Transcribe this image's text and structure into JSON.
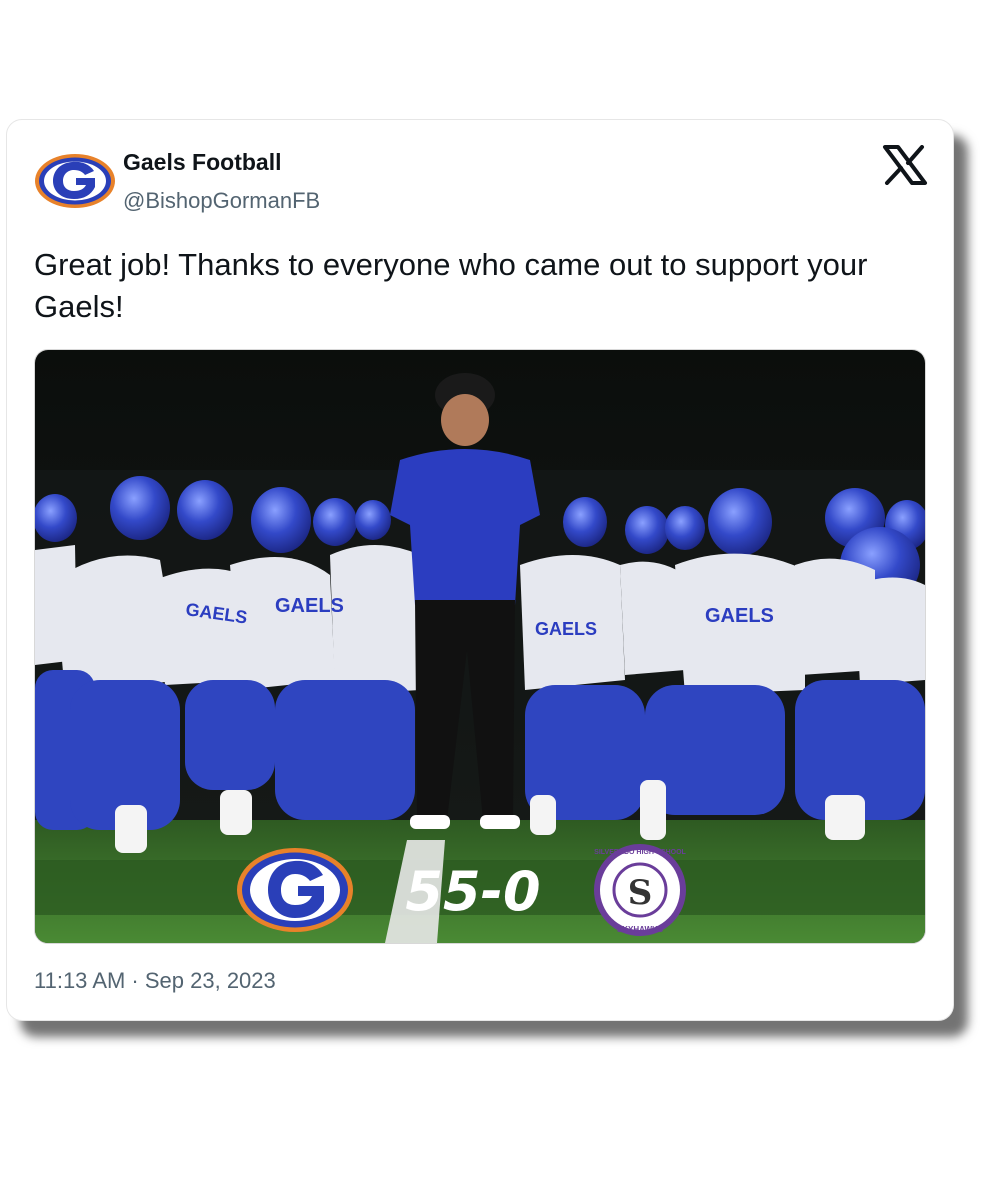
{
  "tweet": {
    "author_name": "Gaels Football",
    "author_handle": "@BishopGormanFB",
    "text": "Great job! Thanks to everyone who came out to support your Gaels!",
    "timestamp": "11:13 AM · Sep 23, 2023"
  },
  "icons": {
    "avatar": "gaels-g-logo",
    "platform": "x-logo"
  },
  "media": {
    "jersey_text": "GAELS",
    "score_text": "55-0",
    "opponent_badge_top": "SILVERADO HIGH SCHOOL",
    "opponent_badge_bottom": "SKYHAWKS",
    "opponent_badge_letter": "S"
  },
  "colors": {
    "gaels_blue": "#2a3fb8",
    "gaels_orange": "#e8822a",
    "skyhawks_purple": "#6a3d9a",
    "field_green": "#3a7a2a"
  }
}
